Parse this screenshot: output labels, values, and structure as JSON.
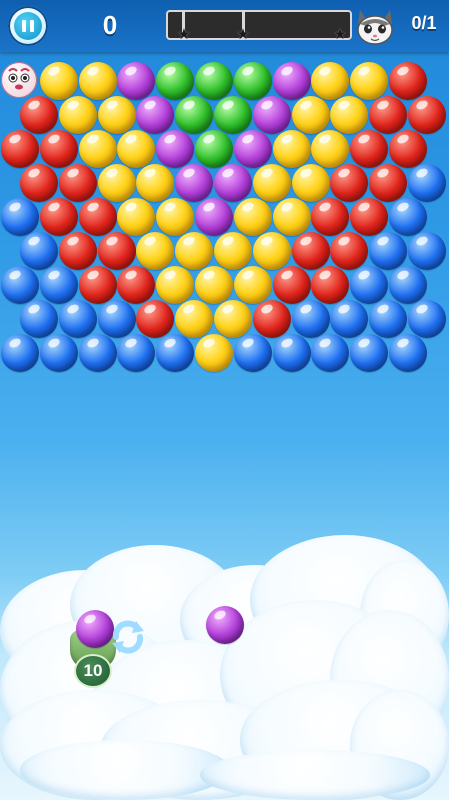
{
  "hud": {
    "score": "0",
    "goal": "0/1",
    "progress_fraction": 0.0,
    "pause_icon": "pause-icon",
    "goal_icon": "cat-face-icon",
    "star_icon": "star-icon"
  },
  "shooter": {
    "shots_left": "10",
    "loaded_color": "purple",
    "next_color": "purple",
    "swap_icon": "swap-arrows-icon"
  },
  "colors": {
    "yellow": "#ffd21a",
    "red": "#e0241b",
    "purple": "#b23fd8",
    "green": "#2fbf2a",
    "blue": "#1e6ff0",
    "hud_bar": "#1a74c9",
    "progress_fill": "#f0a600"
  },
  "board": {
    "rows": [
      [
        "mascot",
        "yellow",
        "yellow",
        "purple",
        "green",
        "green",
        "green",
        "purple",
        "yellow",
        "yellow",
        "red"
      ],
      [
        "red",
        "yellow",
        "yellow",
        "purple",
        "green",
        "green",
        "purple",
        "yellow",
        "yellow",
        "red",
        "red"
      ],
      [
        "red",
        "red",
        "yellow",
        "yellow",
        "purple",
        "green",
        "purple",
        "yellow",
        "yellow",
        "red",
        "red"
      ],
      [
        "red",
        "red",
        "yellow",
        "yellow",
        "purple",
        "purple",
        "yellow",
        "yellow",
        "red",
        "red",
        "blue"
      ],
      [
        "blue",
        "red",
        "red",
        "yellow",
        "yellow",
        "purple",
        "yellow",
        "yellow",
        "red",
        "red",
        "blue"
      ],
      [
        "blue",
        "red",
        "red",
        "yellow",
        "yellow",
        "yellow",
        "yellow",
        "red",
        "red",
        "blue",
        "blue"
      ],
      [
        "blue",
        "blue",
        "red",
        "red",
        "yellow",
        "yellow",
        "yellow",
        "red",
        "red",
        "blue",
        "blue"
      ],
      [
        "blue",
        "blue",
        "blue",
        "red",
        "yellow",
        "yellow",
        "red",
        "blue",
        "blue",
        "blue",
        "blue"
      ],
      [
        "blue",
        "blue",
        "blue",
        "blue",
        "blue",
        "yellow",
        "blue",
        "blue",
        "blue",
        "blue",
        "blue"
      ]
    ]
  }
}
